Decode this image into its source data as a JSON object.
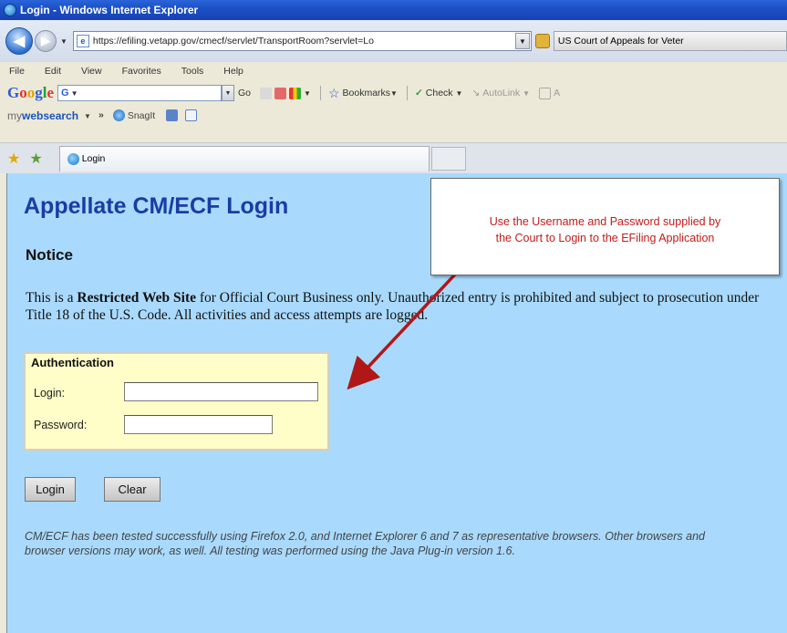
{
  "window": {
    "title": "Login - Windows Internet Explorer"
  },
  "address": {
    "url": "https://efiling.vetapp.gov/cmecf/servlet/TransportRoom?servlet=Lo",
    "site_identity": "US Court of Appeals for Veter"
  },
  "menu": {
    "items": [
      "File",
      "Edit",
      "View",
      "Favorites",
      "Tools",
      "Help"
    ]
  },
  "google_toolbar": {
    "logo": [
      "G",
      "o",
      "o",
      "g",
      "l",
      "e"
    ],
    "search_value": "G",
    "go": "Go",
    "bookmarks": "Bookmarks",
    "check": "Check",
    "autolink": "AutoLink",
    "trailing": "A"
  },
  "mws_toolbar": {
    "my": "my",
    "web": "web",
    "search": "search",
    "more": "»",
    "snagit": "SnagIt"
  },
  "tab": {
    "label": "Login"
  },
  "page": {
    "title": "Appellate CM/ECF Login",
    "notice_heading": "Notice",
    "notice_pre": "This is a ",
    "notice_bold": "Restricted Web Site",
    "notice_post": " for Official Court Business only. Unauthorized entry is prohibited and subject to prosecution under Title 18 of the U.S. Code. All activities and access attempts are logged.",
    "auth_title": "Authentication",
    "login_label": "Login:",
    "login_value": "",
    "password_label": "Password:",
    "password_value": "",
    "login_button": "Login",
    "clear_button": "Clear",
    "footer": "CM/ECF has been tested successfully using Firefox 2.0, and Internet Explorer 6 and 7 as representative browsers. Other browsers and browser versions may work, as well. All testing was performed using the Java Plug-in version 1.6."
  },
  "callout": {
    "line1": "Use the Username and Password supplied by",
    "line2": "the Court to Login to the EFiling Application"
  },
  "colors": {
    "page_bg": "#a9dafd",
    "title_blue": "#1b3ca3",
    "callout_red": "#c21b1b",
    "arrow_red": "#b01818",
    "auth_bg": "#fffec8"
  }
}
